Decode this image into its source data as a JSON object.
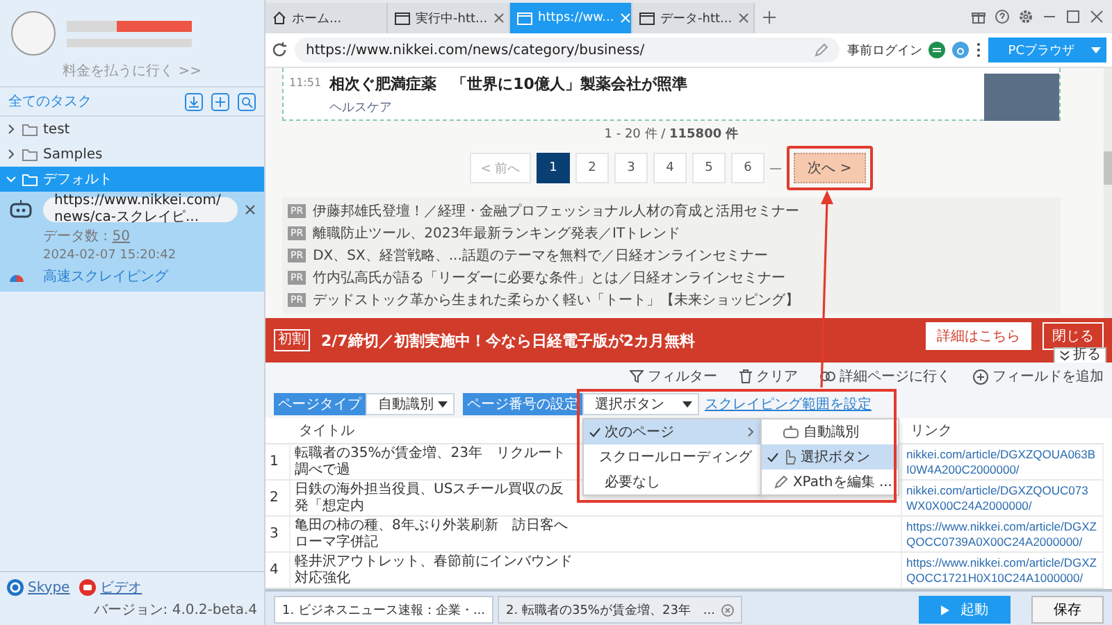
{
  "sidebar": {
    "upgrade_link": "料金を払うに行く >>",
    "tasks_title": "全てのタスク",
    "folders": [
      {
        "label": "test",
        "expanded": false,
        "selected": false
      },
      {
        "label": "Samples",
        "expanded": false,
        "selected": false
      },
      {
        "label": "デフォルト",
        "expanded": true,
        "selected": true,
        "children": [
          {
            "url": "https://www.nikkei.com/news/ca-スクレイピ...",
            "data_label": "データ数 :",
            "data_count": "50",
            "date": "2024-02-07 15:20:42",
            "mode": "高速スクレイピング"
          }
        ]
      }
    ],
    "footer_links": [
      {
        "label": "Skype",
        "kind": "skype"
      },
      {
        "label": "ビデオ",
        "kind": "video"
      }
    ],
    "version": "バージョン: 4.0.2-beta.4"
  },
  "tabs": [
    {
      "label": "ホーム...",
      "kind": "home",
      "selected": false,
      "closable": false
    },
    {
      "label": "実行中-htt...",
      "kind": "page",
      "selected": false,
      "closable": true
    },
    {
      "label": "https://ww...",
      "kind": "page",
      "selected": true,
      "closable": true
    },
    {
      "label": "データ-htt...",
      "kind": "page",
      "selected": false,
      "closable": true
    }
  ],
  "address_bar": {
    "url": "https://www.nikkei.com/news/category/business/",
    "login": "事前ログイン",
    "browser_button": "PCブラウザ"
  },
  "page": {
    "article": {
      "time": "11:51",
      "headline": "相次ぐ肥満症薬　「世界に10億人」製薬会社が照準",
      "category": "ヘルスケア"
    },
    "result_count": "1 - 20 件 / **115800 件**",
    "pagination": {
      "prev": {
        "label": "< 前へ",
        "disabled": true
      },
      "pages": [
        {
          "label": "1",
          "selected": true
        },
        {
          "label": "2",
          "selected": false
        },
        {
          "label": "3",
          "selected": false
        },
        {
          "label": "4",
          "selected": false
        },
        {
          "label": "5",
          "selected": false
        },
        {
          "label": "6",
          "selected": false
        }
      ],
      "next": "次へ >"
    },
    "pr_items": [
      {
        "badge": "PR",
        "text": "伊藤邦雄氏登壇！／経理・金融プロフェッショナル人材の育成と活用セミナー"
      },
      {
        "badge": "PR",
        "text": "離職防止ツール、2023年最新ランキング発表／ITトレンド"
      },
      {
        "badge": "PR",
        "text": "DX、SX、経営戦略、...話題のテーマを無料で／日経オンラインセミナー"
      },
      {
        "badge": "PR",
        "text": "竹内弘高氏が語る「リーダーに必要な条件」とは／日経オンラインセミナー"
      },
      {
        "badge": "PR",
        "text": "デッドストック革から生まれた柔らかく軽い「トート」【未来ショッピング】"
      }
    ]
  },
  "banner": {
    "logo_text": "初割",
    "text": "2/7締切／初割実施中！今なら日経電子版が2カ月無料",
    "details_button": "詳細はこちら",
    "close_button": "閉じる",
    "collapse_button": "折る"
  },
  "toolbar": {
    "page_type_label": "ページタイプ",
    "page_type_value": "自動識別",
    "page_number_label": "ページ番号の設定",
    "page_number_value": "選択ボタン",
    "range_link": "スクレイピング範囲を設定",
    "actions": [
      {
        "label": "フィルター",
        "kind": "filter"
      },
      {
        "label": "クリア",
        "kind": "clear"
      },
      {
        "label": "詳細ページに行く",
        "kind": "link"
      },
      {
        "label": "フィールドを追加",
        "kind": "add"
      }
    ]
  },
  "menu": {
    "items": [
      {
        "label": "次のページ",
        "selected": true,
        "has_submenu": true
      },
      {
        "label": "スクロールローディング",
        "selected": false,
        "has_submenu": false
      },
      {
        "label": "必要なし",
        "selected": false,
        "has_submenu": false
      }
    ],
    "submenu": [
      {
        "label": "自動識別",
        "kind": "auto",
        "selected": false
      },
      {
        "label": "選択ボタン",
        "kind": "click",
        "selected": true
      },
      {
        "label": "XPathを編集 ...",
        "kind": "edit",
        "selected": false
      }
    ]
  },
  "table": {
    "columns": [
      "タイトル",
      "リンク"
    ],
    "rows": [
      {
        "index": "1",
        "title": "転職者の35%が賃金増、23年　リクルート調べで過",
        "link": "nikkei.com/article/DGXZQOUA063BI0W4A200C2000000/"
      },
      {
        "index": "2",
        "title": "日鉄の海外担当役員、USスチール買収の反発「想定内",
        "link": "nikkei.com/article/DGXZQOUC073WX0X00C24A2000000/"
      },
      {
        "index": "3",
        "title": "亀田の柿の種、8年ぶり外装刷新　訪日客へローマ字併記",
        "link": "https://www.nikkei.com/article/DGXZQOCC0739A0X00C24A2000000/"
      },
      {
        "index": "4",
        "title": "軽井沢アウトレット、春節前にインバウンド対応強化",
        "link": "https://www.nikkei.com/article/DGXZQOCC1721H0X10C24A1000000/"
      }
    ]
  },
  "bottom": {
    "tabs": [
      {
        "label": "1. ビジネスニュース速報：企業・...",
        "selected": true,
        "closable": false
      },
      {
        "label": "2. 転職者の35%が賃金増、23年　...",
        "selected": false,
        "closable": true
      }
    ],
    "start_button": "起動",
    "save_button": "保存"
  }
}
